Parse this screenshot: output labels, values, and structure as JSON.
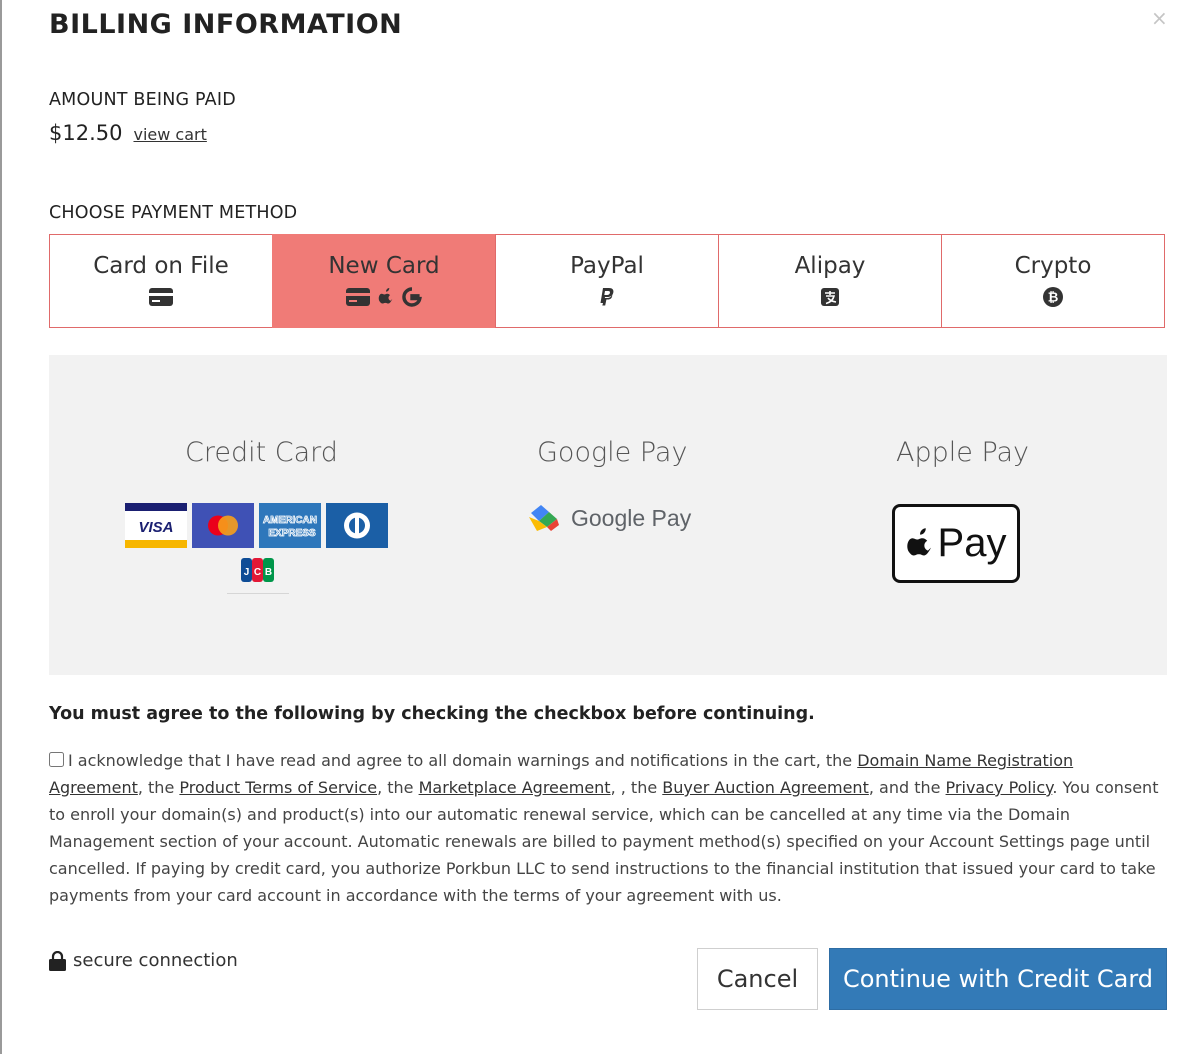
{
  "title": "BILLING INFORMATION",
  "close_label": "×",
  "amount": {
    "heading": "AMOUNT BEING PAID",
    "value": "$12.50",
    "view_cart_label": "view cart"
  },
  "payment": {
    "heading": "CHOOSE PAYMENT METHOD",
    "tabs": [
      {
        "label": "Card on File",
        "icons": [
          "credit-card-icon"
        ],
        "active": false
      },
      {
        "label": "New Card",
        "icons": [
          "credit-card-icon",
          "apple-icon",
          "google-icon"
        ],
        "active": true
      },
      {
        "label": "PayPal",
        "icons": [
          "paypal-icon"
        ],
        "active": false
      },
      {
        "label": "Alipay",
        "icons": [
          "alipay-icon"
        ],
        "active": false
      },
      {
        "label": "Crypto",
        "icons": [
          "bitcoin-icon"
        ],
        "active": false
      }
    ],
    "options": {
      "credit_card": {
        "title": "Credit Card",
        "brands": [
          "VISA",
          "mastercard",
          "AMERICAN EXPRESS",
          "diners-club",
          "JCB"
        ]
      },
      "google_pay": {
        "title": "Google Pay",
        "logo_text": "Google Pay"
      },
      "apple_pay": {
        "title": "Apple Pay",
        "logo_text": "Pay"
      }
    }
  },
  "agreement": {
    "warning": "You must agree to the following by checking the checkbox before continuing.",
    "text_1": "I acknowledge that I have read and agree to all domain warnings and notifications in the cart, the ",
    "link_1": "Domain Name Registration Agreement",
    "text_2": ", the ",
    "link_2": "Product Terms of Service",
    "text_3": ", the ",
    "link_3": "Marketplace Agreement",
    "text_4": ", , the ",
    "link_4": "Buyer Auction Agreement",
    "text_5": ", and the ",
    "link_5": "Privacy Policy",
    "text_6": ". You consent to enroll your domain(s) and product(s) into our automatic renewal service, which can be cancelled at any time via the Domain Management section of your account. Automatic renewals are billed to payment method(s) specified on your Account Settings page until cancelled. If paying by credit card, you authorize Porkbun LLC to send instructions to the financial institution that issued your card to take payments from your card account in accordance with the terms of your agreement with us.",
    "checked": false
  },
  "footer": {
    "secure_label": "secure connection",
    "cancel_label": "Cancel",
    "continue_label": "Continue with Credit Card"
  },
  "colors": {
    "active_tab": "#f07b77",
    "tab_border": "#e06a6a",
    "primary_button": "#337ab7",
    "panel_bg": "#f2f2f2"
  }
}
